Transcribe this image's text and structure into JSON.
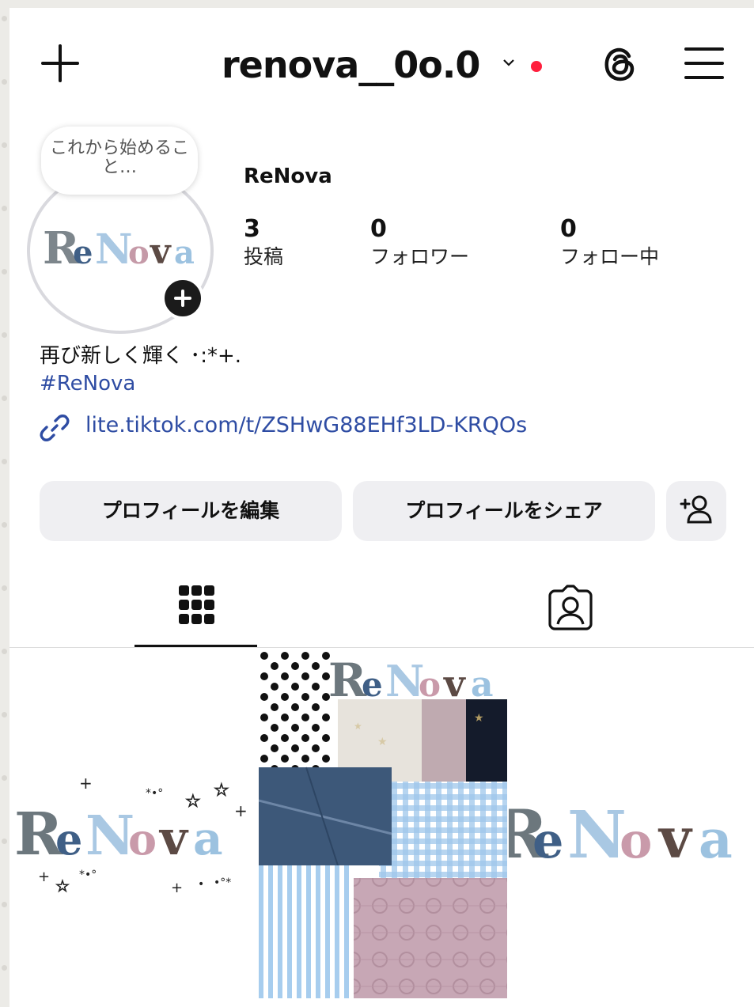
{
  "header": {
    "username": "renova__0o.0",
    "new_post_icon": "plus-icon",
    "dropdown_icon": "chevron-down-icon",
    "notification_color": "#ff1f3d",
    "threads_icon": "threads-icon",
    "menu_icon": "hamburger-menu-icon"
  },
  "profile": {
    "note_bubble": "これから始めること…",
    "avatar_logo_text": "ReNova",
    "display_name": "ReNova",
    "stats": [
      {
        "value": "3",
        "label": "投稿"
      },
      {
        "value": "0",
        "label": "フォロワー"
      },
      {
        "value": "0",
        "label": "フォロー中"
      }
    ],
    "bio": "再び新しく輝く ･:*+.",
    "hashtag": "#ReNova",
    "link": "lite.tiktok.com/t/ZSHwG88EHf3LD-KRQOs",
    "link_color": "#2e4ca3"
  },
  "actions": {
    "edit_profile": "プロフィールを編集",
    "share_profile": "プロフィールをシェア",
    "discover_people_icon": "add-person-icon"
  },
  "tabs": {
    "grid_icon": "grid-icon",
    "tagged_icon": "tagged-person-icon"
  },
  "posts": [
    {
      "logo_text": "ReNova"
    },
    {
      "logo_text": "ReNova"
    },
    {
      "logo_text": "ReNova"
    }
  ]
}
